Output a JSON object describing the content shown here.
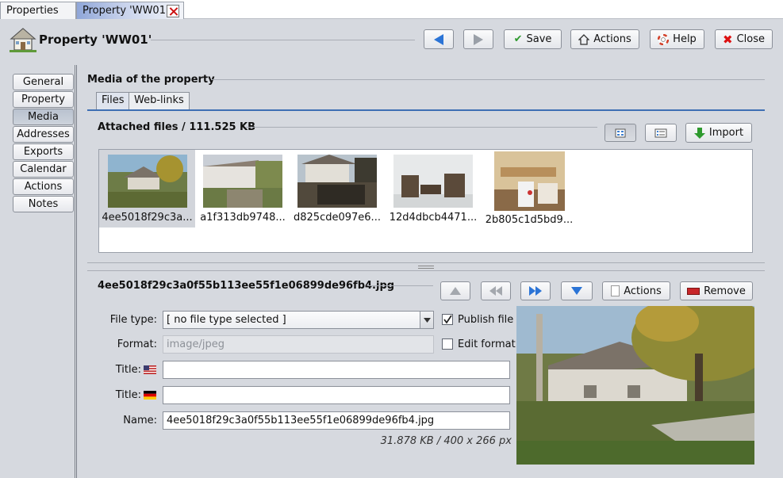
{
  "tabs": [
    {
      "label": "Properties"
    },
    {
      "label": "Property 'WW01'"
    }
  ],
  "header": {
    "title": "Property 'WW01'",
    "buttons": {
      "save": "Save",
      "actions": "Actions",
      "help": "Help",
      "close": "Close"
    }
  },
  "nav": {
    "items": [
      "General",
      "Property",
      "Media",
      "Addresses",
      "Exports",
      "Calendar",
      "Actions",
      "Notes"
    ],
    "selected": "Media"
  },
  "media": {
    "section_title": "Media of the property",
    "subtabs": [
      "Files",
      "Web-links"
    ],
    "attached_label": "Attached files / 111.525 KB",
    "import_label": "Import",
    "thumbnails": [
      {
        "name": "4ee5018f29c3a..."
      },
      {
        "name": "a1f313db9748..."
      },
      {
        "name": "d825cde097e6..."
      },
      {
        "name": "12d4dbcb4471..."
      },
      {
        "name": "2b805c1d5bd9..."
      }
    ]
  },
  "detail": {
    "filename": "4ee5018f29c3a0f55b113ee55f1e06899de96fb4.jpg",
    "actions_label": "Actions",
    "remove_label": "Remove",
    "file_type_label": "File type:",
    "file_type_value": "[ no file type selected ]",
    "publish_label": "Publish file",
    "publish_checked": true,
    "format_label": "Format:",
    "format_value": "image/jpeg",
    "edit_format_label": "Edit format",
    "edit_format_checked": false,
    "title_en_label": "Title:",
    "title_en_value": "",
    "title_de_label": "Title:",
    "title_de_value": "",
    "name_label": "Name:",
    "name_value": "4ee5018f29c3a0f55b113ee55f1e06899de96fb4.jpg",
    "size_info": "31.878 KB / 400 x 266 px"
  }
}
